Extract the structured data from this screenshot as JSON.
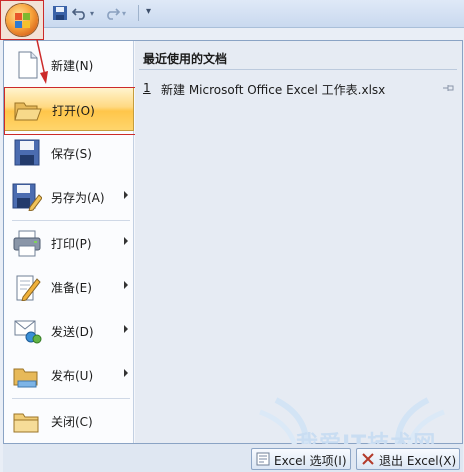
{
  "quick_access": {
    "icons": [
      "office-button-icon",
      "save-icon",
      "undo-icon",
      "redo-icon",
      "customize-icon"
    ]
  },
  "menu": {
    "items": [
      {
        "label": "新建(N)",
        "icon": "new-document-icon",
        "submenu": false
      },
      {
        "label": "打开(O)",
        "icon": "open-folder-icon",
        "submenu": false,
        "active": true
      },
      {
        "label": "保存(S)",
        "icon": "save-disk-icon",
        "submenu": false
      },
      {
        "label": "另存为(A)",
        "icon": "save-as-icon",
        "submenu": true
      },
      {
        "label": "打印(P)",
        "icon": "printer-icon",
        "submenu": true
      },
      {
        "label": "准备(E)",
        "icon": "prepare-pencil-icon",
        "submenu": true
      },
      {
        "label": "发送(D)",
        "icon": "send-icon",
        "submenu": true
      },
      {
        "label": "发布(U)",
        "icon": "publish-icon",
        "submenu": true
      },
      {
        "label": "关闭(C)",
        "icon": "close-folder-icon",
        "submenu": false
      }
    ]
  },
  "recent": {
    "title": "最近使用的文档",
    "items": [
      {
        "number": "1",
        "name": "新建 Microsoft Office Excel 工作表.xlsx"
      }
    ]
  },
  "bottom": {
    "options_label": "Excel 选项(I)",
    "exit_label": "退出 Excel(X)"
  },
  "watermark": {
    "text": "我爱IT技术网"
  },
  "colors": {
    "highlight": "#ffc64a",
    "annotation_red": "#cc2a2a"
  }
}
